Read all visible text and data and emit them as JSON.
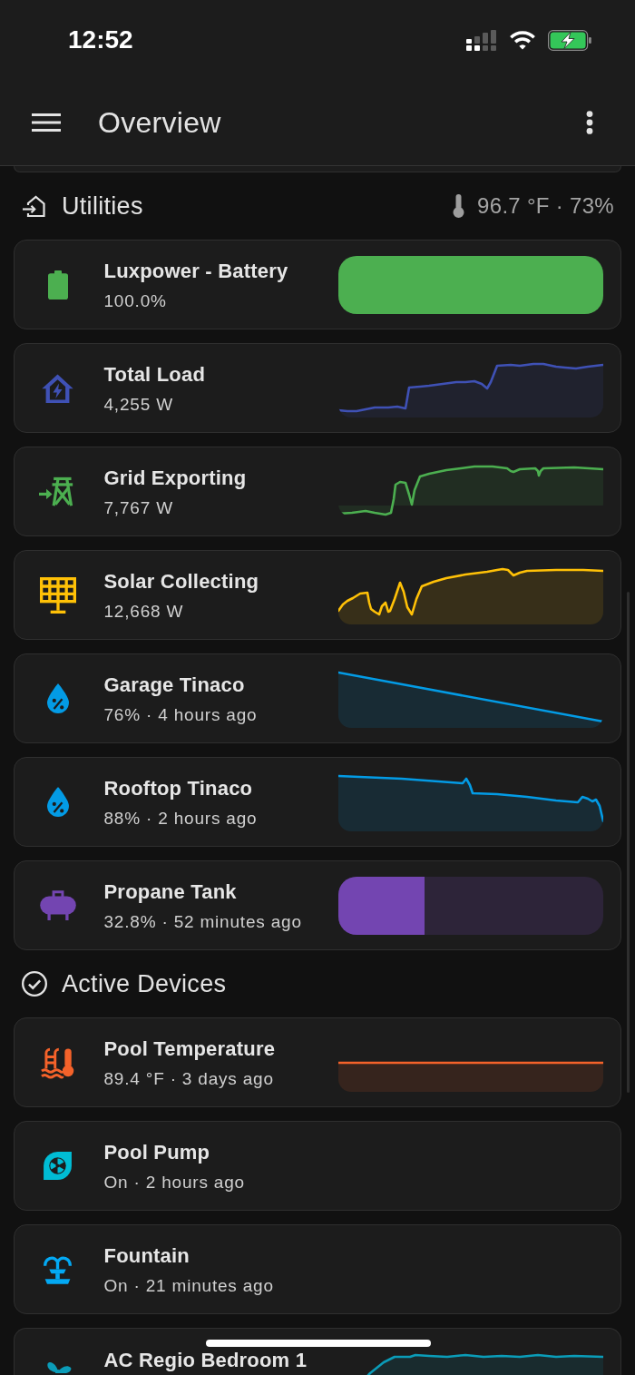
{
  "status_bar": {
    "time": "12:52"
  },
  "app_bar": {
    "title": "Overview"
  },
  "sections": [
    {
      "title": "Utilities",
      "summary": "96.7 °F · 73%",
      "cards": [
        {
          "kind": "bar",
          "name": "Luxpower - Battery",
          "state": "100.0%",
          "color": "#4caf50",
          "level": 1
        },
        {
          "kind": "sparkline",
          "name": "Total Load",
          "state": "4,255 W",
          "color": "#3f51b5"
        },
        {
          "kind": "sparkline",
          "name": "Grid Exporting",
          "state": "7,767 W",
          "color": "#4caf50"
        },
        {
          "kind": "sparkline",
          "name": "Solar Collecting",
          "state": "12,668 W",
          "color": "#ffc107"
        },
        {
          "kind": "sparkline",
          "name": "Garage Tinaco",
          "state": "76% · 4 hours ago",
          "color": "#039be5"
        },
        {
          "kind": "sparkline",
          "name": "Rooftop Tinaco",
          "state": "88% · 2 hours ago",
          "color": "#039be5"
        },
        {
          "kind": "bar",
          "name": "Propane Tank",
          "state": "32.8% · 52 minutes ago",
          "color": "#7345b1",
          "level": 0.328
        }
      ]
    },
    {
      "title": "Active Devices",
      "cards": [
        {
          "kind": "sparkline",
          "name": "Pool Temperature",
          "state": "89.4 °F · 3 days ago",
          "color": "#f4622a"
        },
        {
          "kind": "plain",
          "name": "Pool Pump",
          "state": "On · 2 hours ago",
          "color": "#00bcd4"
        },
        {
          "kind": "plain",
          "name": "Fountain",
          "state": "On · 21 minutes ago",
          "color": "#03a9f4"
        },
        {
          "kind": "sparkline",
          "name": "AC Regio Bedroom 1",
          "color": "#0b9cb8"
        }
      ]
    }
  ]
}
